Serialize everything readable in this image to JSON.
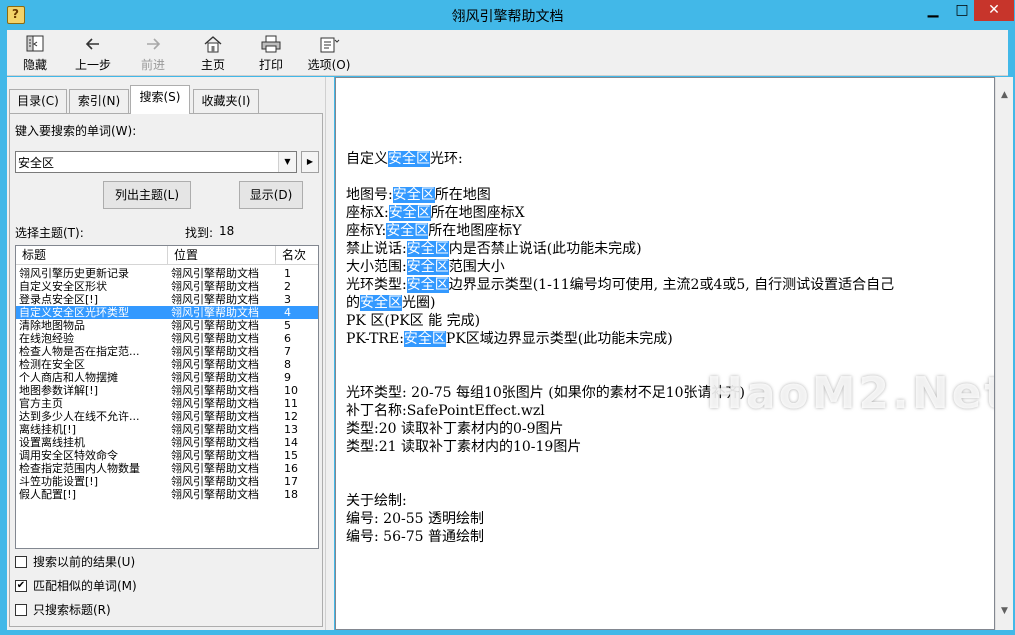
{
  "window": {
    "title": "翎风引擎帮助文档",
    "controls": {
      "minimize": "▁",
      "maximize": "□",
      "close": "✕"
    }
  },
  "toolbar": {
    "hide": "隐藏",
    "back": "上一步",
    "forward": "前进",
    "home": "主页",
    "print": "打印",
    "options": "选项(O)"
  },
  "tabs": {
    "contents": "目录(C)",
    "index": "索引(N)",
    "search": "搜索(S)",
    "favorites": "收藏夹(I)"
  },
  "search": {
    "keyword_label": "键入要搜索的单词(W):",
    "keyword_value": "安全区",
    "list_topics": "列出主题(L)",
    "display": "显示(D)",
    "select_topic_label": "选择主题(T):",
    "found_label": "找到:",
    "found_count": "18"
  },
  "results": {
    "columns": {
      "title": "标题",
      "location": "位置",
      "rank": "名次"
    },
    "rows": [
      {
        "title": "翎风引擎历史更新记录",
        "location": "翎风引擎帮助文档",
        "rank": "1"
      },
      {
        "title": "自定义安全区形状",
        "location": "翎风引擎帮助文档",
        "rank": "2"
      },
      {
        "title": "登录点安全区[!]",
        "location": "翎风引擎帮助文档",
        "rank": "3"
      },
      {
        "title": "自定义安全区光环类型",
        "location": "翎风引擎帮助文档",
        "rank": "4"
      },
      {
        "title": "清除地图物品",
        "location": "翎风引擎帮助文档",
        "rank": "5"
      },
      {
        "title": "在线泡经验",
        "location": "翎风引擎帮助文档",
        "rank": "6"
      },
      {
        "title": "检查人物是否在指定范...",
        "location": "翎风引擎帮助文档",
        "rank": "7"
      },
      {
        "title": "检测在安全区",
        "location": "翎风引擎帮助文档",
        "rank": "8"
      },
      {
        "title": "个人商店和人物摆摊",
        "location": "翎风引擎帮助文档",
        "rank": "9"
      },
      {
        "title": "地图参数详解[!]",
        "location": "翎风引擎帮助文档",
        "rank": "10"
      },
      {
        "title": "官方主页",
        "location": "翎风引擎帮助文档",
        "rank": "11"
      },
      {
        "title": "达到多少人在线不允许...",
        "location": "翎风引擎帮助文档",
        "rank": "12"
      },
      {
        "title": "离线挂机[!]",
        "location": "翎风引擎帮助文档",
        "rank": "13"
      },
      {
        "title": "设置离线挂机",
        "location": "翎风引擎帮助文档",
        "rank": "14"
      },
      {
        "title": "调用安全区特效命令",
        "location": "翎风引擎帮助文档",
        "rank": "15"
      },
      {
        "title": "检查指定范围内人物数量",
        "location": "翎风引擎帮助文档",
        "rank": "16"
      },
      {
        "title": "斗笠功能设置[!]",
        "location": "翎风引擎帮助文档",
        "rank": "17"
      },
      {
        "title": "假人配置[!]",
        "location": "翎风引擎帮助文档",
        "rank": "18"
      }
    ],
    "selected_rank": "4"
  },
  "options": {
    "search_previous": {
      "label": "搜索以前的结果(U)",
      "checked": false
    },
    "match_similar": {
      "label": "匹配相似的单词(M)",
      "checked": true
    },
    "titles_only": {
      "label": "只搜索标题(R)",
      "checked": false
    }
  },
  "document": {
    "heading": {
      "pre": "自定义",
      "hl": "安全区",
      "post": "光环:"
    },
    "params": [
      {
        "pre": "地图号:",
        "hl": "安全区",
        "post": "所在地图"
      },
      {
        "pre": "座标X:",
        "hl": "安全区",
        "post": "所在地图座标X"
      },
      {
        "pre": "座标Y:",
        "hl": "安全区",
        "post": "所在地图座标Y"
      },
      {
        "pre": "禁止说话:",
        "hl": "安全区",
        "post": "内是否禁止说话(此功能未完成)"
      },
      {
        "pre": "大小范围:",
        "hl": "安全区",
        "post": "范围大小"
      },
      {
        "pre": "光环类型:",
        "hl": "安全区",
        "post": "边界显示类型(1-11编号均可使用, 主流2或4或5, 自行测试设置适合自己"
      },
      {
        "pre": "的",
        "hl": "安全区",
        "post": "光圈)"
      },
      {
        "pre": "PK ",
        "hl": "",
        "post": "   区(PK区         能    完成)"
      },
      {
        "pre": "PK-TRE:",
        "hl": "安全区",
        "post": "PK区域边界显示类型(此功能未完成)"
      }
    ],
    "effect_lines": [
      "光环类型:  20-75 每组10张图片 (如果你的素材不足10张请补齐)",
      "补丁名称:SafePointEffect.wzl",
      "类型:20 读取补丁素材内的0-9图片",
      "类型:21 读取补丁素材内的10-19图片"
    ],
    "draw_lines": [
      "关于绘制:",
      "编号:  20-55 透明绘制",
      "编号:  56-75 普通绘制"
    ]
  },
  "watermark": "HaoM2.Net"
}
